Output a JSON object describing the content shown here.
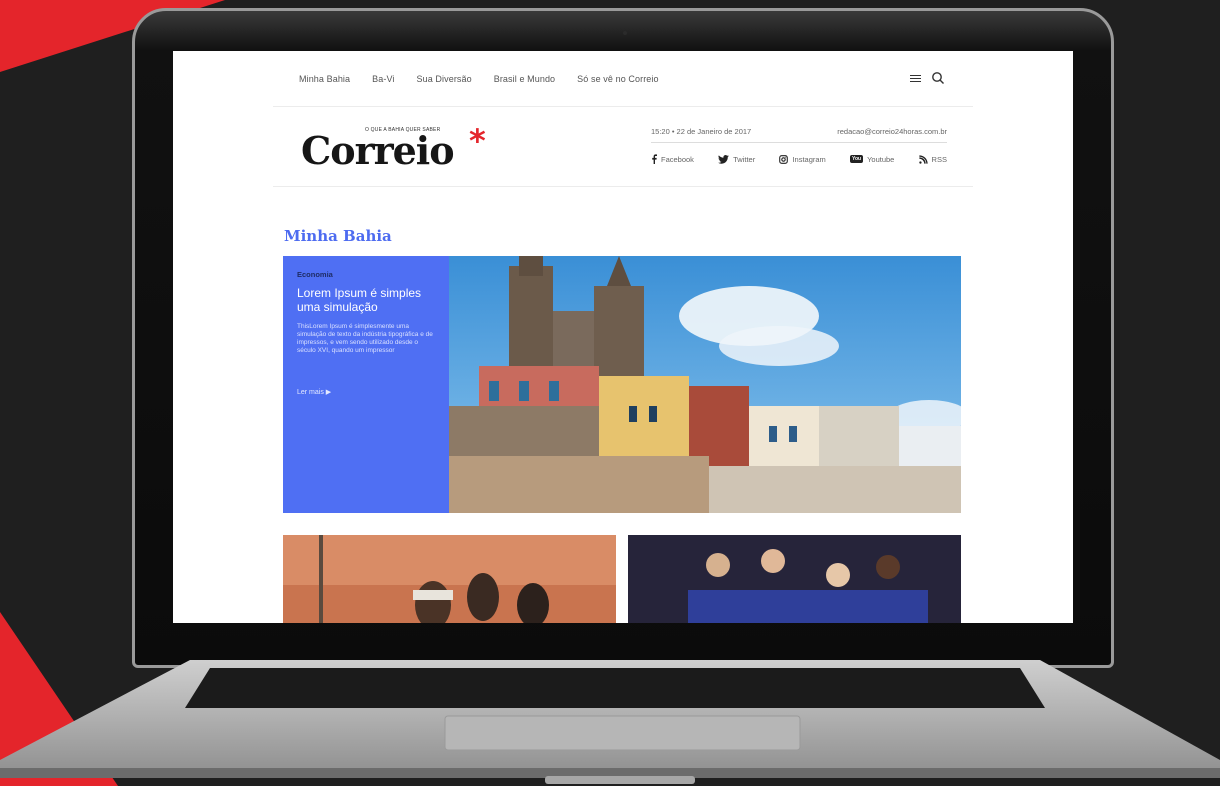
{
  "topnav": {
    "items": [
      "Minha Bahia",
      "Ba-Vi",
      "Sua Diversão",
      "Brasil e Mundo",
      "Só se vê no Correio"
    ]
  },
  "header": {
    "logo_tagline": "O QUE A BAHIA QUER SABER",
    "logo_word": "Correio",
    "datetime": "15:20  •  22 de Janeiro de 2017",
    "email": "redacao@correio24horas.com.br",
    "social": [
      "Facebook",
      "Twitter",
      "Instagram",
      "Youtube",
      "RSS"
    ],
    "youtube_badge": "You"
  },
  "main": {
    "section_title": "Minha Bahia",
    "hero": {
      "category": "Economia",
      "title": "Lorem Ipsum é simples uma simulação",
      "text": "ThisLorem Ipsum é simplesmente uma simulação de texto da indústria tipográfica e de impressos, e vem sendo utilizado desde o século XVI, quando um impressor",
      "more": "Ler mais ▶"
    }
  },
  "colors": {
    "accent_blue": "#4f6ff3",
    "brand_red": "#e4252b",
    "background_dark": "#1f1f1f"
  }
}
